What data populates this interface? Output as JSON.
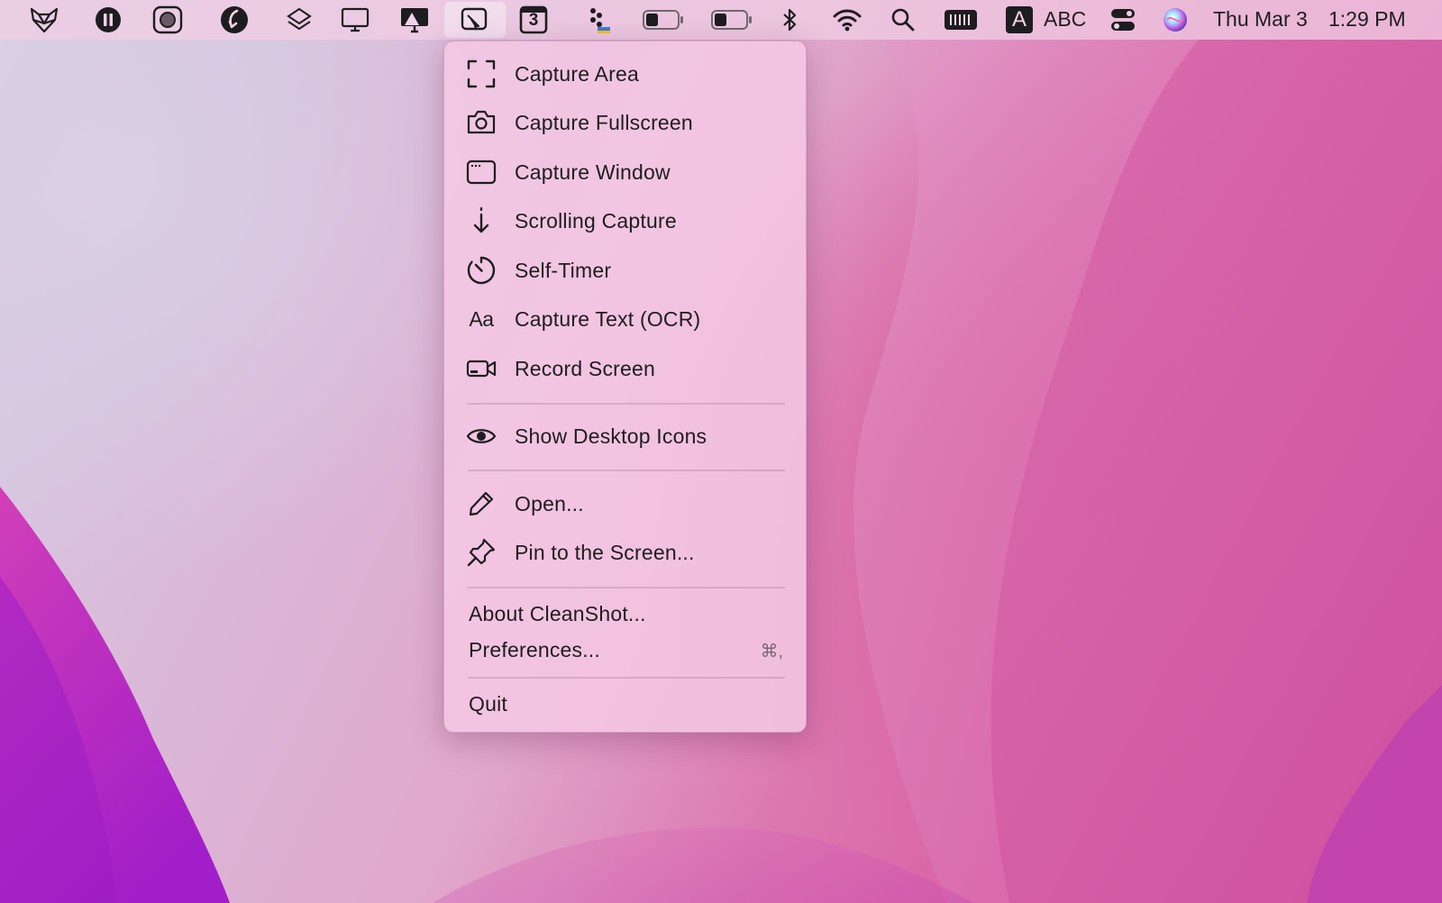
{
  "menubar": {
    "active_app": "CleanShot",
    "badge_number": "3",
    "input_letter": "A",
    "input_source": "ABC",
    "clock": {
      "date": "Thu Mar 3",
      "time": "1:29 PM"
    },
    "icons": [
      "fox-icon",
      "pause-icon",
      "screen-record-icon",
      "scroll-icon",
      "layers-icon",
      "display-icon",
      "tv-icon",
      "cleanshot-icon",
      "calendar-icon",
      "dots-icon",
      "battery-icon",
      "battery-icon",
      "bluetooth-icon",
      "wifi-icon",
      "search-icon",
      "memory-icon",
      "input-source-icon",
      "control-center-icon",
      "siri-icon"
    ]
  },
  "menu": {
    "capture_items": [
      {
        "label": "Capture Area",
        "icon": "capture-area-icon"
      },
      {
        "label": "Capture Fullscreen",
        "icon": "camera-icon"
      },
      {
        "label": "Capture Window",
        "icon": "window-icon"
      },
      {
        "label": "Scrolling Capture",
        "icon": "arrow-down-icon"
      },
      {
        "label": "Self-Timer",
        "icon": "timer-icon"
      },
      {
        "label": "Capture Text (OCR)",
        "icon": "text-aa-icon"
      },
      {
        "label": "Record Screen",
        "icon": "video-camera-icon"
      }
    ],
    "ocr_glyph": "Aa",
    "show_desktop_icons": {
      "label": "Show Desktop Icons",
      "icon": "eye-icon"
    },
    "open": {
      "label": "Open...",
      "icon": "pencil-icon"
    },
    "pin": {
      "label": "Pin to the Screen...",
      "icon": "pin-icon"
    },
    "about": "About CleanShot...",
    "preferences": "Preferences...",
    "preferences_shortcut": "⌘,",
    "quit": "Quit"
  }
}
